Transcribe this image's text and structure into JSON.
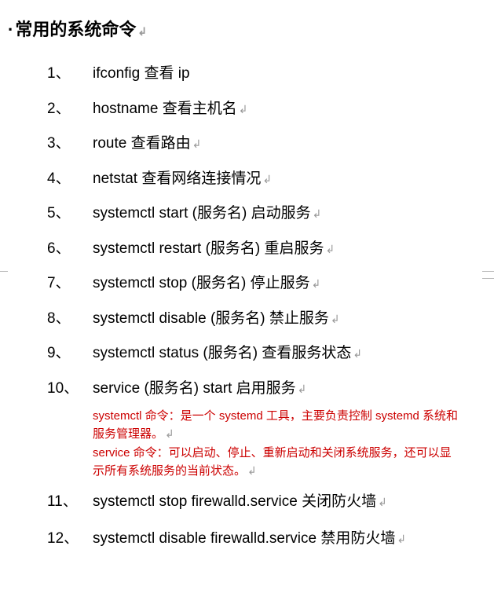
{
  "title": {
    "bullet": "·",
    "text": "常用的系统命令",
    "return_mark": "↲"
  },
  "items": [
    {
      "num": "1、",
      "text": "ifconfig  查看 ip"
    },
    {
      "num": "2、",
      "text": "hostname  查看主机名"
    },
    {
      "num": "3、",
      "text": "route  查看路由"
    },
    {
      "num": "4、",
      "text": "netstat  查看网络连接情况"
    },
    {
      "num": "5、",
      "text": "systemctl start (服务名)    启动服务"
    },
    {
      "num": "6、",
      "text": "systemctl restart (服务名)   重启服务"
    },
    {
      "num": "7、",
      "text": "systemctl stop (服务名)  停止服务"
    },
    {
      "num": "8、",
      "text": "systemctl disable (服务名)  禁止服务"
    },
    {
      "num": "9、",
      "text": "systemctl status (服务名) 查看服务状态"
    },
    {
      "num": "10、",
      "text": "service (服务名) start  启用服务"
    },
    {
      "num": "11、",
      "text": "systemctl stop firewalld.service 关闭防火墙"
    },
    {
      "num": "12、",
      "text": "systemctl  disable  firewalld.service  禁用防火墙"
    }
  ],
  "notes": [
    "systemctl 命令：是一个 systemd 工具，主要负责控制 systemd 系统和服务管理器。",
    "service 命令：可以启动、停止、重新启动和关闭系统服务，还可以显示所有系统服务的当前状态。"
  ],
  "return_mark": "↲"
}
